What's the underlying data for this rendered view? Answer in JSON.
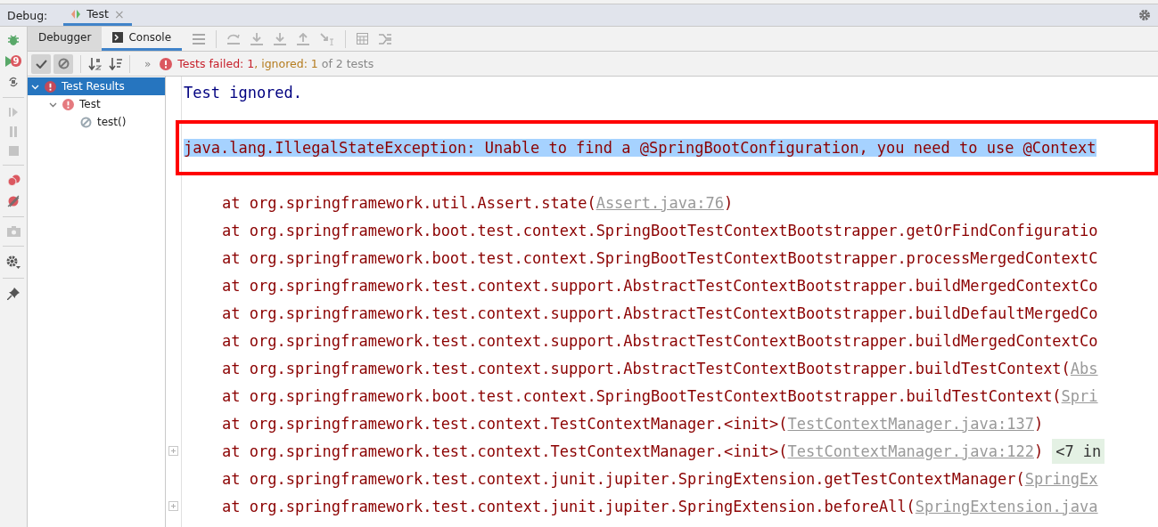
{
  "header": {
    "label": "Debug:",
    "tabs": [
      {
        "label": "Test",
        "selected": true,
        "close": "×"
      }
    ]
  },
  "toolbar": {
    "tabs": [
      {
        "label": "Debugger",
        "selected": false,
        "hovered": true,
        "icon": false
      },
      {
        "label": "Console",
        "selected": true,
        "hovered": false,
        "icon": true
      }
    ]
  },
  "side_tools": [
    {
      "kind": "bug"
    },
    {
      "kind": "rerun",
      "badge": "9"
    },
    {
      "kind": "layout"
    },
    {
      "kind": "sep"
    },
    {
      "kind": "resume"
    },
    {
      "kind": "pause"
    },
    {
      "kind": "stop"
    },
    {
      "kind": "sep"
    },
    {
      "kind": "breakpoints"
    },
    {
      "kind": "mute"
    },
    {
      "kind": "sep"
    },
    {
      "kind": "camera"
    },
    {
      "kind": "sep"
    },
    {
      "kind": "gear"
    },
    {
      "kind": "sep"
    },
    {
      "kind": "pin"
    }
  ],
  "test_toolbar": {
    "show_passed": true,
    "show_ignored": true,
    "more": "»"
  },
  "status": {
    "parts": [
      {
        "text": "Tests failed: ",
        "kind": "fail"
      },
      {
        "text": "1",
        "kind": "fail"
      },
      {
        "text": ", ignored: ",
        "kind": "ignored"
      },
      {
        "text": "1",
        "kind": "ignored"
      },
      {
        "text": " of 2 tests",
        "kind": "plain"
      }
    ]
  },
  "tree": [
    {
      "label": "Test Results",
      "kind": "failed",
      "selected": true,
      "expanded": true,
      "children": [
        {
          "label": "Test",
          "kind": "failed",
          "selected": false,
          "expanded": true,
          "children": [
            {
              "label": "test()",
              "kind": "ignored",
              "selected": false
            }
          ]
        }
      ]
    }
  ],
  "console": {
    "lines": [
      {
        "kind": "info",
        "text": "Test ignored."
      },
      {
        "kind": "blank"
      },
      {
        "kind": "exception",
        "text": "java.lang.IllegalStateException: Unable to find a @SpringBootConfiguration, you need to use @Context",
        "highlighted": true,
        "boxed": true
      },
      {
        "kind": "blank"
      },
      {
        "kind": "frame",
        "text": "at org.springframework.util.Assert.state(",
        "link": "Assert.java:76",
        "close": ")"
      },
      {
        "kind": "frame",
        "text": "at org.springframework.boot.test.context.SpringBootTestContextBootstrapper.getOrFindConfiguratio"
      },
      {
        "kind": "frame",
        "text": "at org.springframework.boot.test.context.SpringBootTestContextBootstrapper.processMergedContextC"
      },
      {
        "kind": "frame",
        "text": "at org.springframework.test.context.support.AbstractTestContextBootstrapper.buildMergedContextCo"
      },
      {
        "kind": "frame",
        "text": "at org.springframework.test.context.support.AbstractTestContextBootstrapper.buildDefaultMergedCo"
      },
      {
        "kind": "frame",
        "text": "at org.springframework.test.context.support.AbstractTestContextBootstrapper.buildMergedContextCo"
      },
      {
        "kind": "frame",
        "text": "at org.springframework.test.context.support.AbstractTestContextBootstrapper.buildTestContext(",
        "link": "Abs"
      },
      {
        "kind": "frame",
        "text": "at org.springframework.boot.test.context.SpringBootTestContextBootstrapper.buildTestContext(",
        "link": "Spri"
      },
      {
        "kind": "frame",
        "text": "at org.springframework.test.context.TestContextManager.<init>(",
        "link": "TestContextManager.java:137",
        "close": ")"
      },
      {
        "kind": "frame",
        "text": "at org.springframework.test.context.TestContextManager.<init>(",
        "link": "TestContextManager.java:122",
        "close": ")",
        "folded": "<7 in",
        "expandable": true
      },
      {
        "kind": "frame",
        "text": "at org.springframework.test.context.junit.jupiter.SpringExtension.getTestContextManager(",
        "link": "SpringEx"
      },
      {
        "kind": "frame",
        "text": "at org.springframework.test.context.junit.jupiter.SpringExtension.beforeAll(",
        "link": "SpringExtension.java",
        "expandable": true
      }
    ]
  }
}
